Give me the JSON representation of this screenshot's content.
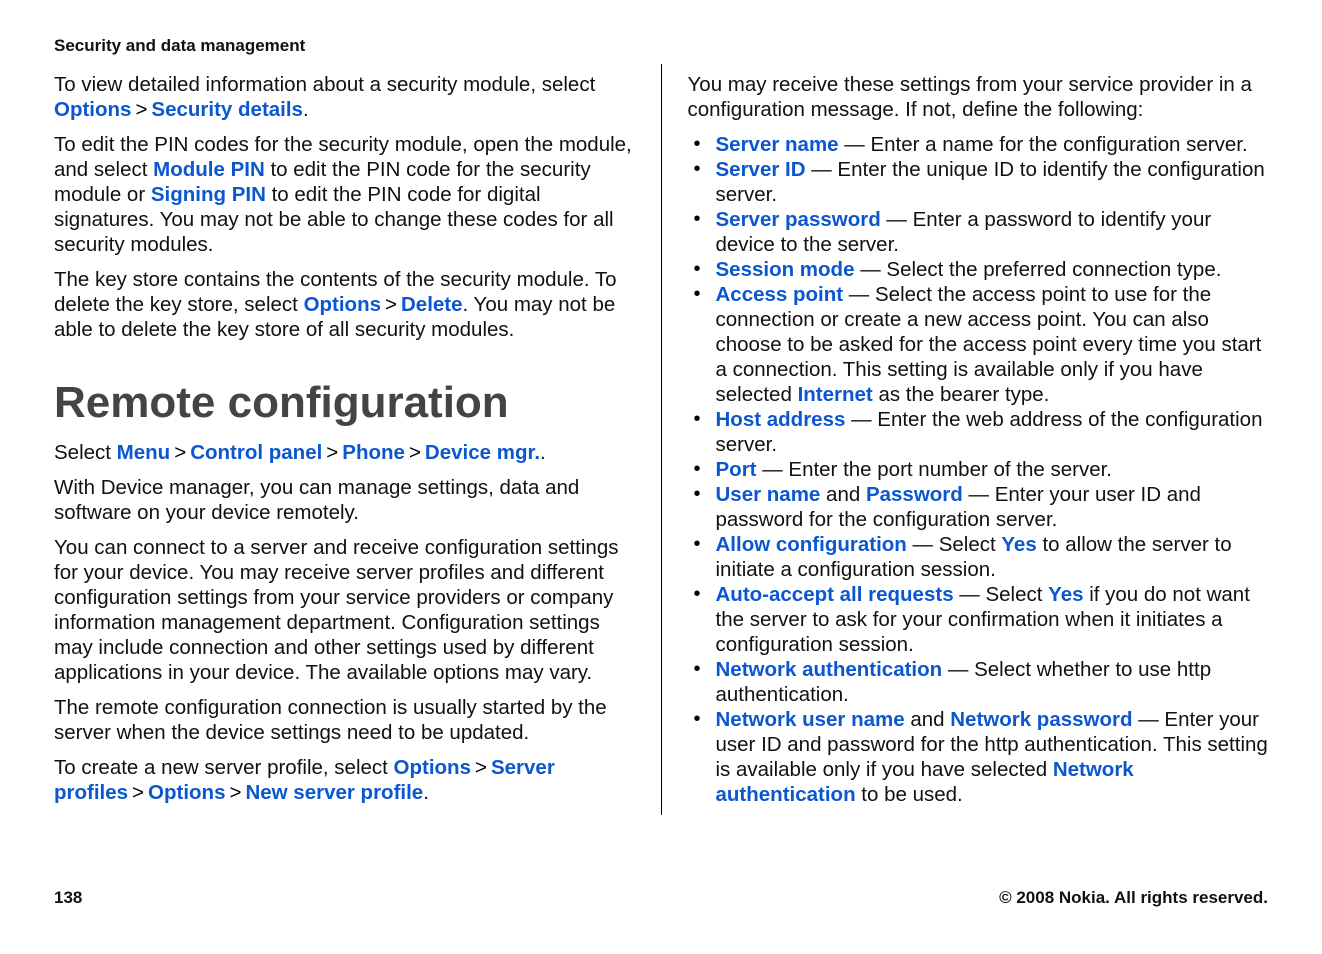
{
  "header": "Security and data management",
  "left": {
    "p1": {
      "t1": "To view detailed information about a security module, select ",
      "options": "Options",
      "gt": ">",
      "secdetails": "Security details",
      "t2": "."
    },
    "p2": {
      "t1": "To edit the PIN codes for the security module, open the module, and select ",
      "modulepin": "Module PIN",
      "t2": " to edit the PIN code for the security module or ",
      "signingpin": "Signing PIN",
      "t3": " to edit the PIN code for digital signatures. You may not be able to change these codes for all security modules."
    },
    "p3": {
      "t1": "The key store contains the contents of the security module. To delete the key store, select ",
      "options": "Options",
      "gt": ">",
      "delete": "Delete",
      "t2": ". You may not be able to delete the key store of all security modules."
    },
    "h2": "Remote configuration",
    "p4": {
      "t1": "Select ",
      "menu": "Menu",
      "gt1": ">",
      "cp": "Control panel",
      "gt2": ">",
      "phone": "Phone",
      "gt3": ">",
      "dmgr": "Device mgr.",
      "t2": "."
    },
    "p5": "With Device manager, you can manage settings, data and software on your device remotely.",
    "p6": "You can connect to a server and receive configuration settings for your device. You may receive server profiles and different configuration settings from your service providers or company information management department. Configuration settings may include connection and other settings used by different applications in your device. The available options may vary.",
    "p7": "The remote configuration connection is usually started by the server when the device settings need to be updated.",
    "p8": {
      "t1": "To create a new server profile, select ",
      "options1": "Options",
      "gt1": ">",
      "serverprofiles": "Server profiles",
      "gt2": ">",
      "options2": "Options",
      "gt3": ">",
      "newserver": "New server profile",
      "t2": "."
    }
  },
  "right": {
    "p1": "You may receive these settings from your service provider in a configuration message. If not, define the following:",
    "items": [
      {
        "label": "Server name",
        "text": " — Enter a name for the configuration server."
      },
      {
        "label": "Server ID",
        "text": " — Enter the unique ID to identify the configuration server."
      },
      {
        "label": "Server password",
        "text": " — Enter a password to identify your device to the server."
      },
      {
        "label": "Session mode",
        "text": " — Select the preferred connection type."
      },
      {
        "label": "Access point",
        "pre": " — Select the access point to use for the connection or create a new access point. You can also choose to be asked for the access point every time you start a connection. This setting is available only if you have selected ",
        "mid": "Internet",
        "post": " as the bearer type."
      },
      {
        "label": "Host address",
        "text": " — Enter the web address of the configuration server."
      },
      {
        "label": "Port",
        "text": " — Enter the port number of the server."
      },
      {
        "label": "User name",
        "conj": " and ",
        "label2": "Password",
        "text": " — Enter your user ID and password for the configuration server."
      },
      {
        "label": "Allow configuration",
        "pre": " — Select ",
        "mid": "Yes",
        "post": " to allow the server to initiate a configuration session."
      },
      {
        "label": "Auto-accept all requests",
        "pre": " — Select ",
        "mid": "Yes",
        "post": " if you do not want the server to ask for your confirmation when it initiates a configuration session."
      },
      {
        "label": "Network authentication",
        "text": " — Select whether to use http authentication."
      },
      {
        "label": "Network user name",
        "conj": " and ",
        "label2": "Network password",
        "pre": " — Enter your user ID and password for the http authentication. This setting is available only if you have selected ",
        "mid": "Network authentication",
        "post": " to be used."
      }
    ]
  },
  "footer": {
    "page": "138",
    "copyright": "© 2008 Nokia. All rights reserved."
  }
}
